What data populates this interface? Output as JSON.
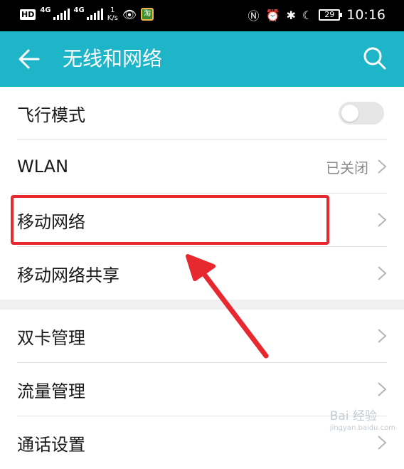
{
  "status_bar": {
    "hd": "HD",
    "network1": "4G",
    "network2": "4G",
    "speed_value": "1",
    "speed_unit": "K/s",
    "app_icon_text": "淘",
    "battery": "29",
    "time": "10:16"
  },
  "header": {
    "title": "无线和网络",
    "background_color": "#1eb5c8"
  },
  "items": [
    {
      "label": "飞行模式",
      "toggle_on": false
    },
    {
      "label": "WLAN",
      "value": "已关闭"
    },
    {
      "label": "移动网络"
    },
    {
      "label": "移动网络共享"
    },
    {
      "label": "双卡管理"
    },
    {
      "label": "流量管理"
    },
    {
      "label": "通话设置"
    }
  ],
  "watermark": {
    "brand": "Bai 经验",
    "url": "jingyan.baidu.com"
  },
  "annotation": {
    "highlight_color": "#e8282f"
  }
}
